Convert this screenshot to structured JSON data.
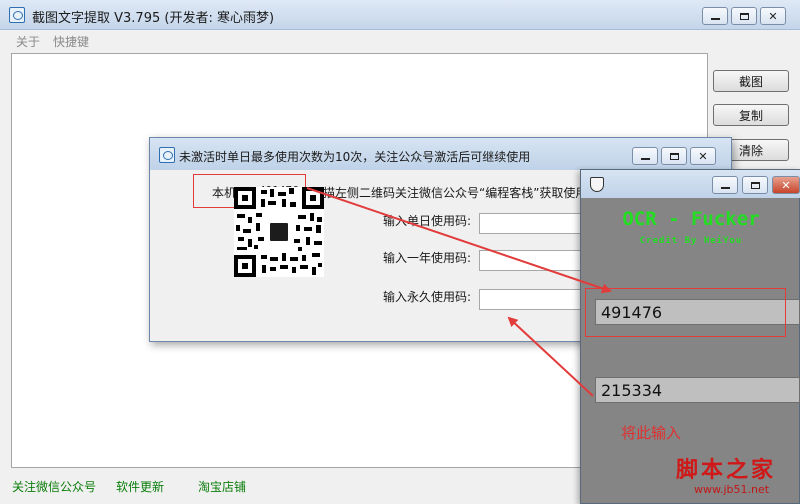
{
  "main_window": {
    "title": "截图文字提取 V3.795 (开发者: 寒心雨梦)",
    "menu": [
      "关于",
      "快捷键"
    ],
    "buttons": {
      "capture": "截图",
      "copy": "复制",
      "clear": "清除"
    },
    "footer_links": [
      "关注微信公众号",
      "软件更新",
      "淘宝店铺"
    ]
  },
  "activation_dialog": {
    "title": "未激活时单日最多使用次数为10次，关注公众号激活后可继续使用",
    "machine_id_label": "本机ID:",
    "machine_id": "491476",
    "instruction": "扫描左侧二维码关注微信公众号“编程客栈”获取使用",
    "code_labels": [
      "输入单日使用码:",
      "输入一年使用码:",
      "输入永久使用码:"
    ],
    "code_values": [
      "",
      "",
      ""
    ]
  },
  "ocr_tool": {
    "title": "OCR - Fucker",
    "credit": "Credit By HeiYou",
    "input_id": "491476",
    "output_code": "215334",
    "hint": "将此输入"
  },
  "watermark": {
    "cn": "脚本之家",
    "url": "www.jb51.net"
  },
  "colors": {
    "accent_green": "#22dd22",
    "annotation_red": "#e23b3b",
    "link_green": "#0a7d0a"
  },
  "icons": {
    "app": "capture-app-icon",
    "ocr": "shield-icon"
  }
}
